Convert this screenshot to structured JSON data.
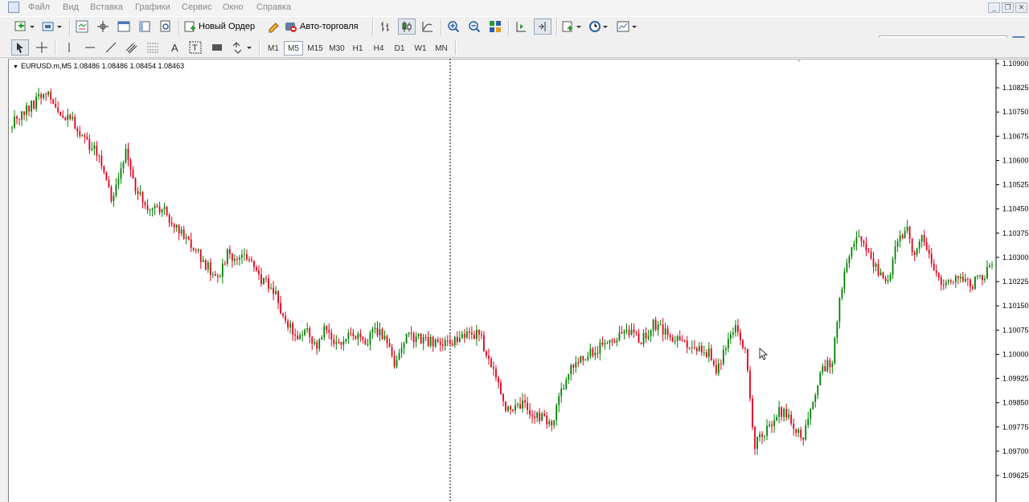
{
  "menu": {
    "items": [
      "Файл",
      "Вид",
      "Вставка",
      "Графики",
      "Сервис",
      "Окно",
      "Справка"
    ]
  },
  "toolbar": {
    "new_order_label": "Новый Ордер",
    "auto_trading_label": "Авто-торговля"
  },
  "timeframes": [
    "M1",
    "M5",
    "M15",
    "M30",
    "H1",
    "H4",
    "D1",
    "W1",
    "MN"
  ],
  "active_timeframe": "M5",
  "search": {
    "value": ""
  },
  "colors": {
    "bull": "#008000",
    "bear": "#e0001a",
    "grid_text": "#000000"
  },
  "chart": {
    "header": "EURUSD.m,M5  1.08486 1.08486 1.08454 1.08463",
    "price_labels": [
      "1.10900",
      "1.10825",
      "1.10750",
      "1.10675",
      "1.10600",
      "1.10525",
      "1.10450",
      "1.10375",
      "1.10300",
      "1.10225",
      "1.10150",
      "1.10075",
      "1.10000",
      "1.09925",
      "1.09850",
      "1.09775",
      "1.09700",
      "1.09625"
    ]
  },
  "chart_data": {
    "type": "candlestick",
    "symbol": "EURUSD.m",
    "timeframe": "M5",
    "ohlc_header": [
      1.08486,
      1.08486,
      1.08454,
      1.08463
    ],
    "ylim": [
      1.09625,
      1.109
    ],
    "y_ticks": [
      1.109,
      1.10825,
      1.1075,
      1.10675,
      1.106,
      1.10525,
      1.1045,
      1.10375,
      1.103,
      1.10225,
      1.1015,
      1.10075,
      1.1,
      1.09925,
      1.0985,
      1.09775,
      1.097,
      1.09625
    ],
    "path": [
      [
        0,
        1.1072
      ],
      [
        7,
        1.1076
      ],
      [
        14,
        1.1082
      ],
      [
        18,
        1.1076
      ],
      [
        25,
        1.1072
      ],
      [
        31,
        1.1066
      ],
      [
        37,
        1.106
      ],
      [
        41,
        1.1048
      ],
      [
        44,
        1.1054
      ],
      [
        47,
        1.1062
      ],
      [
        51,
        1.1052
      ],
      [
        57,
        1.1044
      ],
      [
        62,
        1.1046
      ],
      [
        67,
        1.104
      ],
      [
        72,
        1.1035
      ],
      [
        77,
        1.1031
      ],
      [
        82,
        1.1026
      ],
      [
        86,
        1.1025
      ],
      [
        89,
        1.1032
      ],
      [
        93,
        1.1029
      ],
      [
        97,
        1.1031
      ],
      [
        101,
        1.1025
      ],
      [
        105,
        1.1022
      ],
      [
        109,
        1.1018
      ],
      [
        113,
        1.1011
      ],
      [
        117,
        1.1005
      ],
      [
        122,
        1.1007
      ],
      [
        126,
        1.1002
      ],
      [
        130,
        1.1009
      ],
      [
        134,
        1.1003
      ],
      [
        140,
        1.1006
      ],
      [
        146,
        1.1004
      ],
      [
        152,
        1.1008
      ],
      [
        158,
        1.0998
      ],
      [
        164,
        1.1006
      ],
      [
        170,
        1.1004
      ],
      [
        178,
        1.1003
      ],
      [
        185,
        1.1005
      ],
      [
        193,
        1.1006
      ],
      [
        199,
        1.0996
      ],
      [
        203,
        1.0985
      ],
      [
        207,
        1.0982
      ],
      [
        211,
        1.0985
      ],
      [
        215,
        1.0982
      ],
      [
        219,
        1.098
      ],
      [
        223,
        1.0978
      ],
      [
        227,
        1.0988
      ],
      [
        231,
        1.0996
      ],
      [
        235,
        1.0998
      ],
      [
        241,
        1.1001
      ],
      [
        247,
        1.1004
      ],
      [
        253,
        1.1008
      ],
      [
        259,
        1.1004
      ],
      [
        265,
        1.1009
      ],
      [
        271,
        1.1006
      ],
      [
        277,
        1.1003
      ],
      [
        282,
        1.1002
      ],
      [
        288,
        1.1
      ],
      [
        291,
        1.0994
      ],
      [
        295,
        1.1003
      ],
      [
        299,
        1.1008
      ],
      [
        303,
        1.1002
      ],
      [
        305,
        1.0986
      ],
      [
        307,
        1.0972
      ],
      [
        312,
        1.0977
      ],
      [
        317,
        1.0983
      ],
      [
        322,
        1.0979
      ],
      [
        327,
        1.0974
      ],
      [
        331,
        1.0986
      ],
      [
        335,
        1.0996
      ],
      [
        339,
        1.0998
      ],
      [
        342,
        1.1016
      ],
      [
        346,
        1.1032
      ],
      [
        350,
        1.1037
      ],
      [
        354,
        1.103
      ],
      [
        358,
        1.1025
      ],
      [
        362,
        1.1022
      ],
      [
        366,
        1.1035
      ],
      [
        370,
        1.1038
      ],
      [
        373,
        1.1031
      ],
      [
        376,
        1.1038
      ],
      [
        380,
        1.1029
      ],
      [
        384,
        1.102
      ],
      [
        388,
        1.1024
      ],
      [
        393,
        1.1023
      ],
      [
        397,
        1.1022
      ],
      [
        401,
        1.1024
      ],
      [
        405,
        1.1027
      ]
    ],
    "total_candles": 406,
    "grid": false
  }
}
